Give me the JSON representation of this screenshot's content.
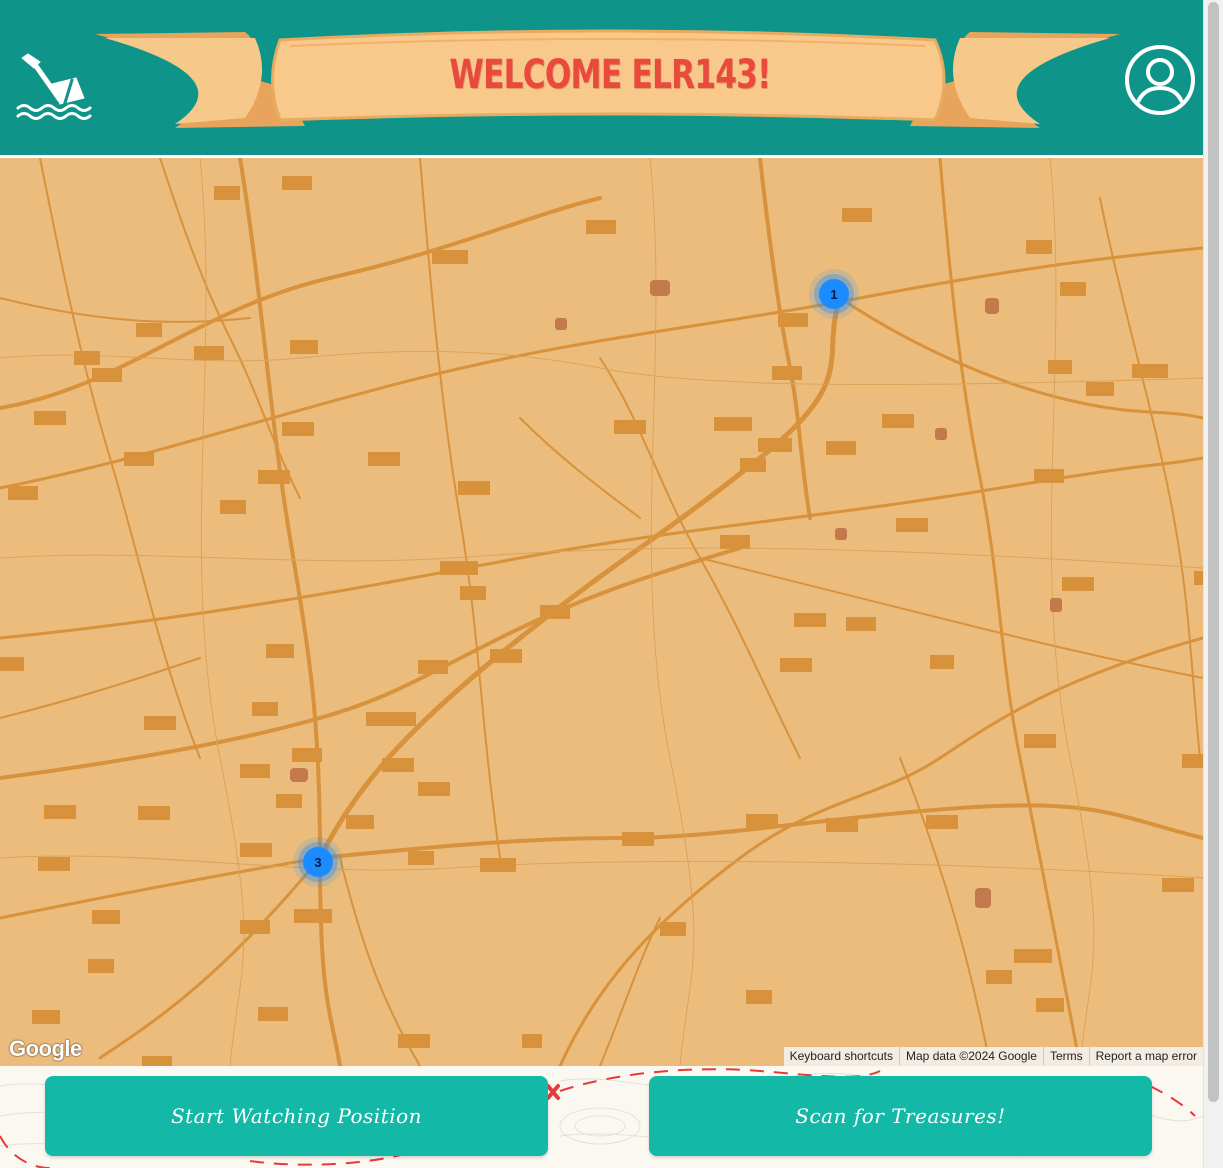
{
  "header": {
    "title": "WELCOME ELR143!",
    "logo_icon": "shipwreck-icon",
    "profile_icon": "user-profile-icon",
    "background_color": "#0e9488",
    "title_color": "#ea4a3e"
  },
  "map": {
    "clusters": [
      {
        "count": "1"
      },
      {
        "count": "3"
      }
    ],
    "google_logo": "Google",
    "attribution": {
      "keyboard_shortcuts": "Keyboard shortcuts",
      "map_data": "Map data ©2024 Google",
      "terms": "Terms",
      "report": "Report a map error"
    },
    "land_color": "#ecbc7c",
    "road_color": "#d8923c"
  },
  "footer": {
    "watch_button": "Start Watching Position",
    "scan_button": "Scan for Treasures!",
    "button_color": "#14b8a6"
  }
}
